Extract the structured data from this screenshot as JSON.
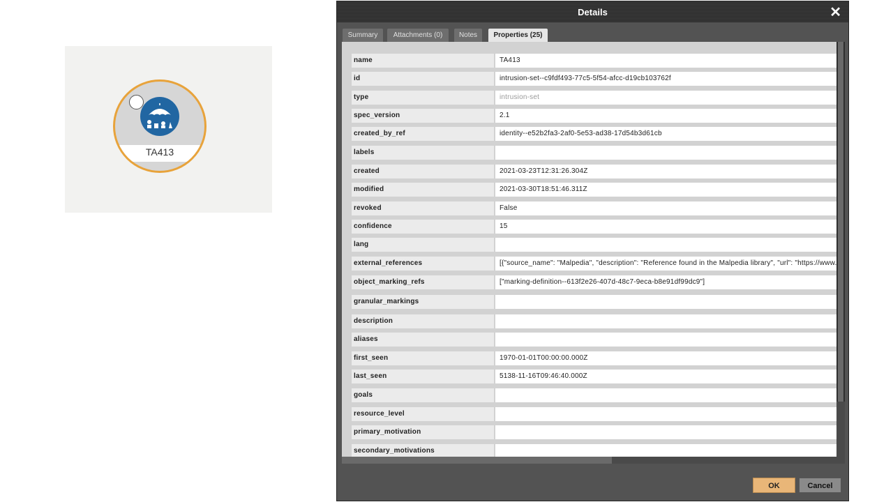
{
  "node": {
    "label": "TA413",
    "icon": "intrusion-set-umbrella-icon",
    "colors": {
      "ring": "#e8a33b",
      "icon_bg": "#2166a2"
    }
  },
  "dialog": {
    "title": "Details",
    "close_glyph": "✕",
    "tabs": [
      {
        "label": "Summary",
        "active": false
      },
      {
        "label": "Attachments (0)",
        "active": false
      },
      {
        "label": "Notes",
        "active": false
      },
      {
        "label": "Properties (25)",
        "active": true
      }
    ],
    "properties": [
      {
        "key": "name",
        "value": "TA413"
      },
      {
        "key": "id",
        "value": "intrusion-set--c9fdf493-77c5-5f54-afcc-d19cb103762f"
      },
      {
        "key": "type",
        "value": "intrusion-set"
      },
      {
        "key": "spec_version",
        "value": "2.1"
      },
      {
        "key": "created_by_ref",
        "value": "identity--e52b2fa3-2af0-5e53-ad38-17d54b3d61cb"
      },
      {
        "key": "labels",
        "value": ""
      },
      {
        "key": "created",
        "value": "2021-03-23T12:31:26.304Z"
      },
      {
        "key": "modified",
        "value": "2021-03-30T18:51:46.311Z"
      },
      {
        "key": "revoked",
        "value": "False"
      },
      {
        "key": "confidence",
        "value": "15"
      },
      {
        "key": "lang",
        "value": ""
      },
      {
        "key": "external_references",
        "value": "[{\"source_name\": \"Malpedia\", \"description\": \"Reference found in the Malpedia library\", \"url\": \"https://www.pro"
      },
      {
        "key": "object_marking_refs",
        "value": "[\"marking-definition--613f2e26-407d-48c7-9eca-b8e91df99dc9\"]"
      },
      {
        "key": "granular_markings",
        "value": ""
      },
      {
        "key": "description",
        "value": ""
      },
      {
        "key": "aliases",
        "value": ""
      },
      {
        "key": "first_seen",
        "value": "1970-01-01T00:00:00.000Z"
      },
      {
        "key": "last_seen",
        "value": "5138-11-16T09:46:40.000Z"
      },
      {
        "key": "goals",
        "value": ""
      },
      {
        "key": "resource_level",
        "value": ""
      },
      {
        "key": "primary_motivation",
        "value": ""
      },
      {
        "key": "secondary_motivations",
        "value": ""
      }
    ],
    "ok_label": "OK",
    "cancel_label": "Cancel"
  }
}
